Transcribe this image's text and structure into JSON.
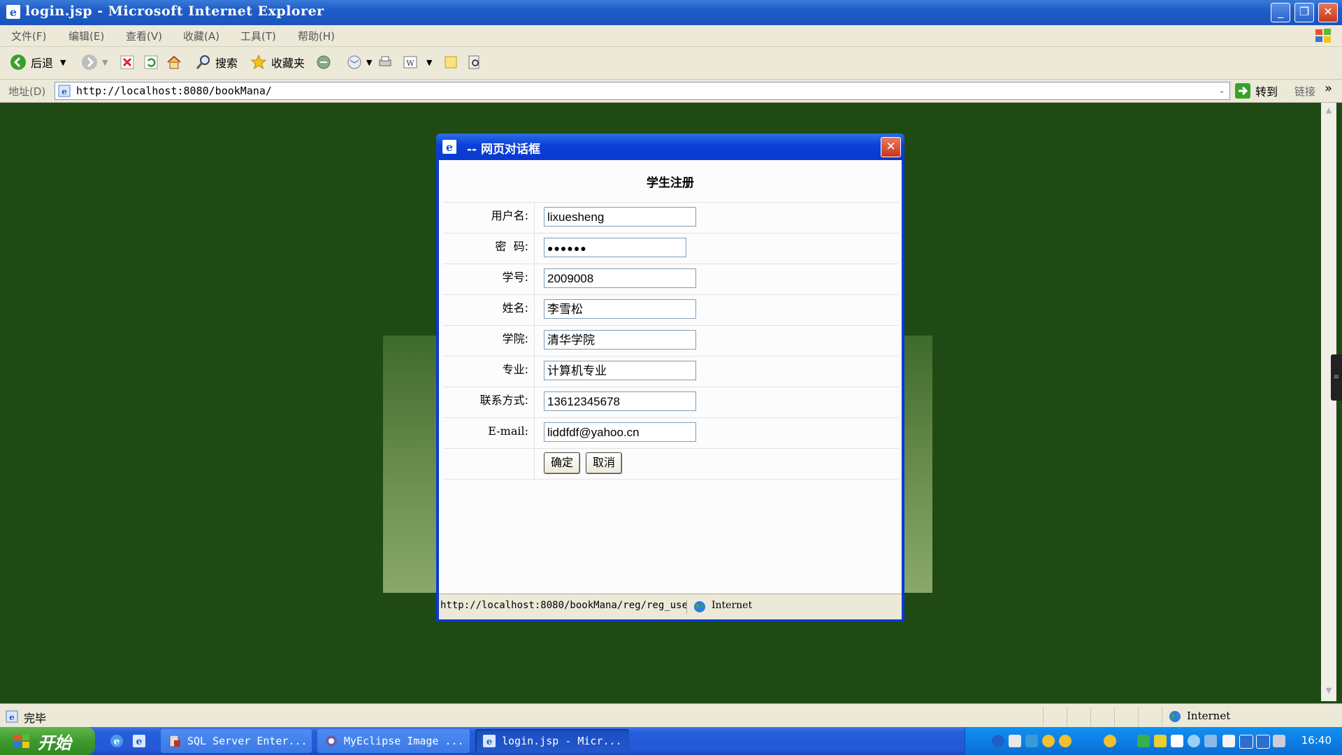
{
  "window": {
    "title": "login.jsp - Microsoft Internet Explorer"
  },
  "menu": [
    "文件(F)",
    "编辑(E)",
    "查看(V)",
    "收藏(A)",
    "工具(T)",
    "帮助(H)"
  ],
  "toolbar": {
    "back_label": "后退",
    "search_label": "搜索",
    "favorites_label": "收藏夹"
  },
  "address": {
    "label": "地址(D)",
    "url": "http://localhost:8080/bookMana/",
    "go_label": "转到",
    "links_label": "链接"
  },
  "dialog": {
    "title": "-- 网页对话框",
    "form_title": "学生注册",
    "fields": [
      {
        "label": "用户名:",
        "value": "lixuesheng"
      },
      {
        "label": "密  码:",
        "value": "●●●●●●"
      },
      {
        "label": "学号:",
        "value": "2009008"
      },
      {
        "label": "姓名:",
        "value": "李雪松"
      },
      {
        "label": "学院:",
        "value": "清华学院"
      },
      {
        "label": "专业:",
        "value": "计算机专业"
      },
      {
        "label": "联系方式:",
        "value": "13612345678"
      },
      {
        "label": "E-mail:",
        "value": "liddfdf@yahoo.cn"
      }
    ],
    "ok_label": "确定",
    "cancel_label": "取消",
    "status_url": "http://localhost:8080/bookMana/reg/reg_use",
    "status_zone": "Internet"
  },
  "statusbar": {
    "text": "完毕",
    "zone": "Internet"
  },
  "taskbar": {
    "start_label": "开始",
    "tasks": [
      "SQL Server Enter...",
      "MyEclipse Image ...",
      "login.jsp - Micr..."
    ],
    "clock": "16:40"
  },
  "colors": {
    "desktop_green": "#1f4a14",
    "xp_blue": "#245edb",
    "start_green": "#3e9a2e"
  }
}
